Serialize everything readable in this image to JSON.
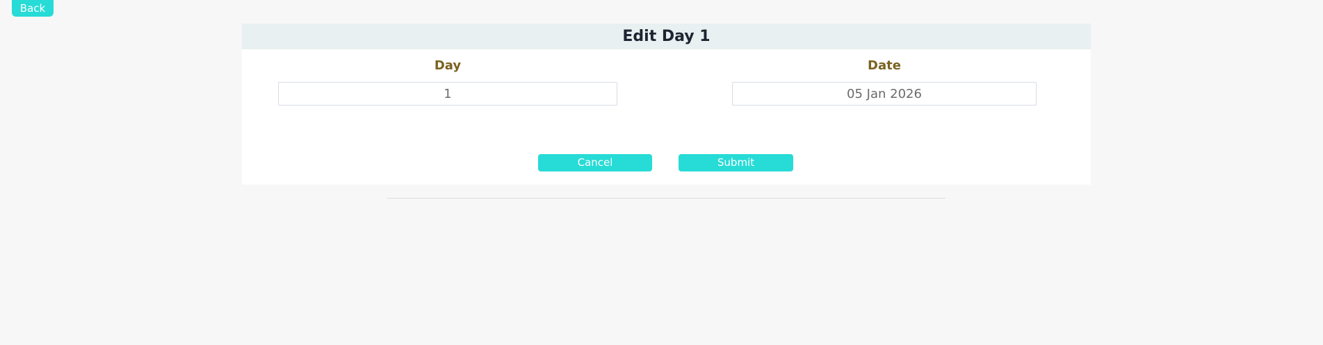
{
  "nav": {
    "back_label": "Back"
  },
  "form": {
    "title": "Edit Day 1",
    "day": {
      "label": "Day",
      "value": "1"
    },
    "date": {
      "label": "Date",
      "value": "05 Jan 2026"
    },
    "cancel_label": "Cancel",
    "submit_label": "Submit"
  },
  "colors": {
    "accent": "#27dbd6",
    "label": "#7a6220",
    "header_bg": "#e8f0f1"
  }
}
